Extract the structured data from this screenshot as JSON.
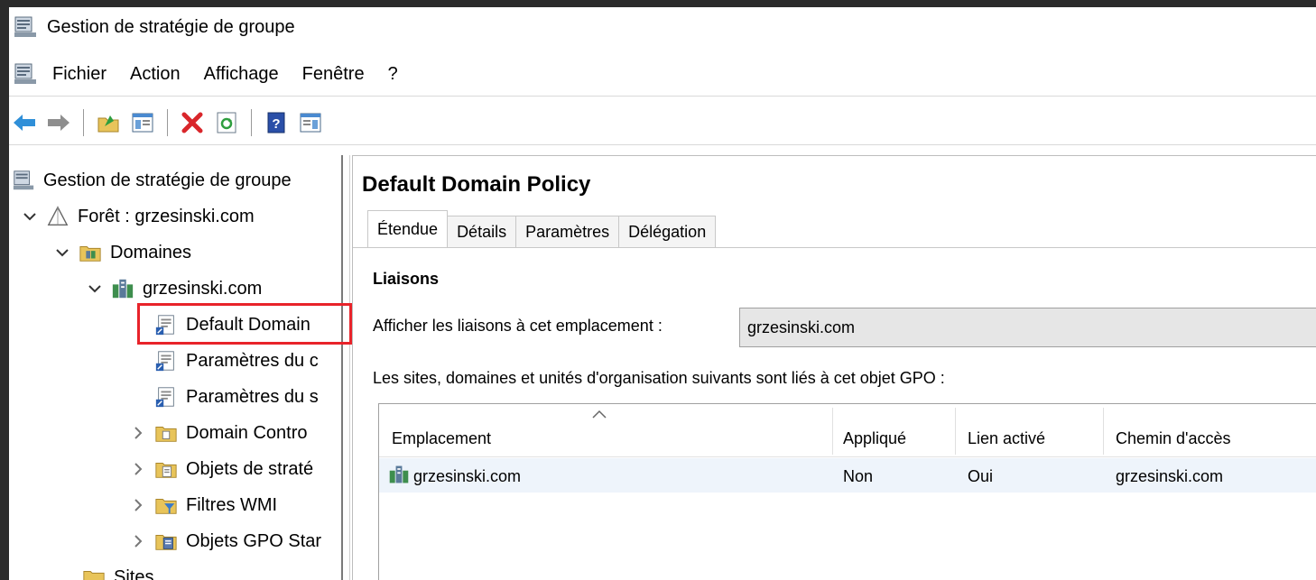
{
  "window": {
    "title": "Gestion de stratégie de groupe"
  },
  "menu": [
    "Fichier",
    "Action",
    "Affichage",
    "Fenêtre",
    "?"
  ],
  "toolbar": [
    "back-icon",
    "forward-icon",
    "up-folder-icon",
    "show-hide-tree-icon",
    "delete-icon",
    "refresh-icon",
    "help-icon",
    "show-action-pane-icon"
  ],
  "tree": {
    "root": "Gestion de stratégie de groupe",
    "forest": "Forêt : grzesinski.com",
    "domains": "Domaines",
    "domain": "grzesinski.com",
    "items": [
      "Default Domain",
      "Paramètres du c",
      "Paramètres du s",
      "Domain Contro",
      "Objets de straté",
      "Filtres WMI",
      "Objets GPO Star"
    ],
    "sites": "Sites"
  },
  "gpo": {
    "title": "Default Domain Policy",
    "tabs": [
      "Étendue",
      "Détails",
      "Paramètres",
      "Délégation"
    ],
    "active_tab": "Étendue",
    "section": "Liaisons",
    "display_label": "Afficher les liaisons à cet emplacement :",
    "display_value": "grzesinski.com",
    "description": "Les sites, domaines et unités d'organisation suivants sont liés à cet objet GPO :",
    "columns": [
      "Emplacement",
      "Appliqué",
      "Lien activé",
      "Chemin d'accès"
    ],
    "rows": [
      {
        "location": "grzesinski.com",
        "enforced": "Non",
        "enabled": "Oui",
        "path": "grzesinski.com"
      }
    ]
  },
  "colors": {
    "selection_outline": "#e8232a",
    "row_bg": "#eef4fb"
  }
}
